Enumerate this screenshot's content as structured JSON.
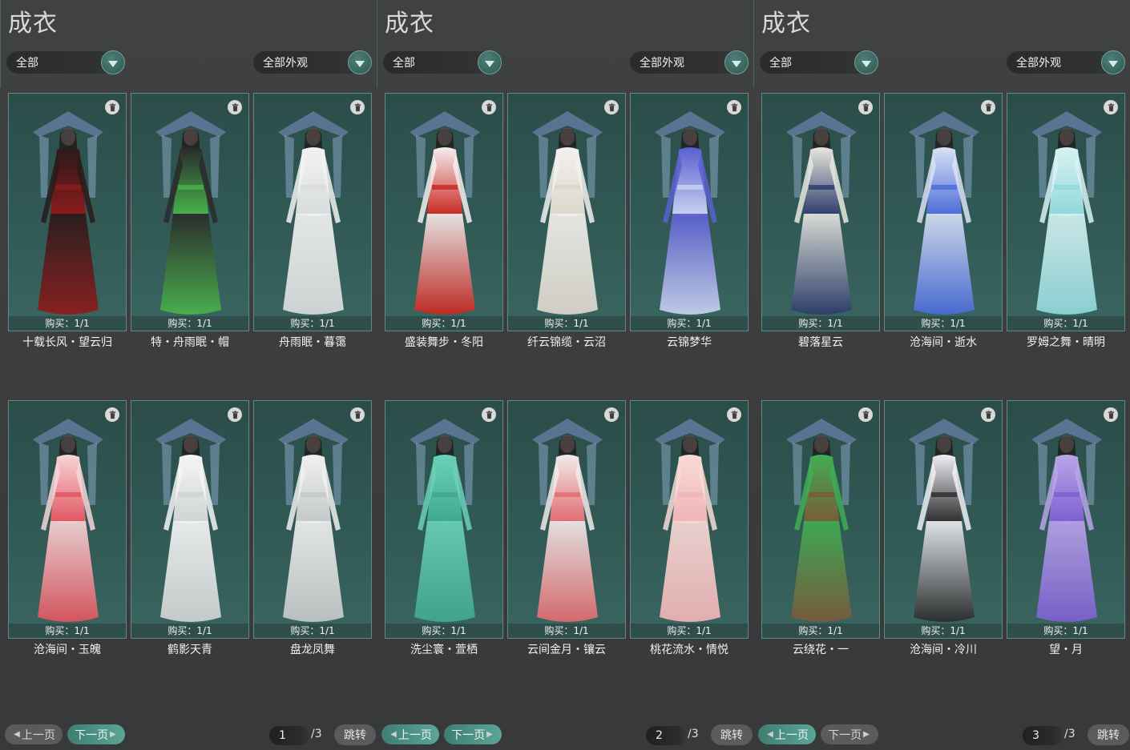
{
  "panels": [
    {
      "title": "成衣",
      "filter_left": "全部",
      "filter_right": "全部外观",
      "items": [
        {
          "buy": "购买：1/1",
          "name": "十载长风・望云归",
          "colors": [
            "#2a1a1a",
            "#8e1b1b"
          ]
        },
        {
          "buy": "购买：1/1",
          "name": "特・舟雨眠・帽",
          "colors": [
            "#2a2a2a",
            "#49b54b"
          ]
        },
        {
          "buy": "购买：1/1",
          "name": "舟雨眠・暮霭",
          "colors": [
            "#f2f2f2",
            "#d9dcdc"
          ]
        },
        {
          "buy": "购买：1/1",
          "name": "沧海间・玉魄",
          "colors": [
            "#f6d6d8",
            "#e0545e"
          ]
        },
        {
          "buy": "购买：1/1",
          "name": "鹤影天青",
          "colors": [
            "#f5f5f5",
            "#cfd3d3"
          ]
        },
        {
          "buy": "购买：1/1",
          "name": "盘龙凤舞",
          "colors": [
            "#f0f0f0",
            "#c4c8c8"
          ]
        }
      ],
      "pager": {
        "prev": "上一页",
        "next": "下一页",
        "prev_active": false,
        "next_active": true,
        "page": "1",
        "total": "/3",
        "jump": "跳转"
      }
    },
    {
      "title": "成衣",
      "filter_left": "全部",
      "filter_right": "全部外观",
      "items": [
        {
          "buy": "购买：1/1",
          "name": "盛装舞步・冬阳",
          "colors": [
            "#f4eeee",
            "#c9251f"
          ]
        },
        {
          "buy": "购买：1/1",
          "name": "纤云锦缆・云沼",
          "colors": [
            "#f3f1ee",
            "#dcd6cc"
          ]
        },
        {
          "buy": "购买：1/1",
          "name": "云锦梦华",
          "colors": [
            "#5a5fd0",
            "#c9d3f0"
          ]
        },
        {
          "buy": "购买：1/1",
          "name": "洗尘寰・萱栖",
          "colors": [
            "#6cd0b8",
            "#40a890"
          ]
        },
        {
          "buy": "购买：1/1",
          "name": "云间金月・镶云",
          "colors": [
            "#f2eaea",
            "#e06a6e"
          ]
        },
        {
          "buy": "购买：1/1",
          "name": "桃花流水・情悦",
          "colors": [
            "#f7dad6",
            "#f0b4b8"
          ]
        }
      ],
      "pager": {
        "prev": "上一页",
        "next": "下一页",
        "prev_active": true,
        "next_active": true,
        "page": "2",
        "total": "/3",
        "jump": "跳转"
      }
    },
    {
      "title": "成衣",
      "filter_left": "全部",
      "filter_right": "全部外观",
      "items": [
        {
          "buy": "购买：1/1",
          "name": "碧落星云",
          "colors": [
            "#e8e6df",
            "#2b3a6a"
          ]
        },
        {
          "buy": "购买：1/1",
          "name": "沧海间・逝水",
          "colors": [
            "#d8e2f6",
            "#4a6ad8"
          ]
        },
        {
          "buy": "购买：1/1",
          "name": "罗姆之舞・晴明",
          "colors": [
            "#d8f2f2",
            "#8fd8dc"
          ]
        },
        {
          "buy": "购买：1/1",
          "name": "云绕花・一",
          "colors": [
            "#3fae54",
            "#7a5a3a"
          ]
        },
        {
          "buy": "购买：1/1",
          "name": "沧海间・冷川",
          "colors": [
            "#eeeef4",
            "#2a2a2a"
          ]
        },
        {
          "buy": "购买：1/1",
          "name": "望・月",
          "colors": [
            "#b9a4e8",
            "#7d5fd0"
          ]
        }
      ],
      "pager": {
        "prev": "上一页",
        "next": "下一页",
        "prev_active": true,
        "next_active": false,
        "page": "3",
        "total": "/3",
        "jump": "跳转"
      }
    }
  ]
}
